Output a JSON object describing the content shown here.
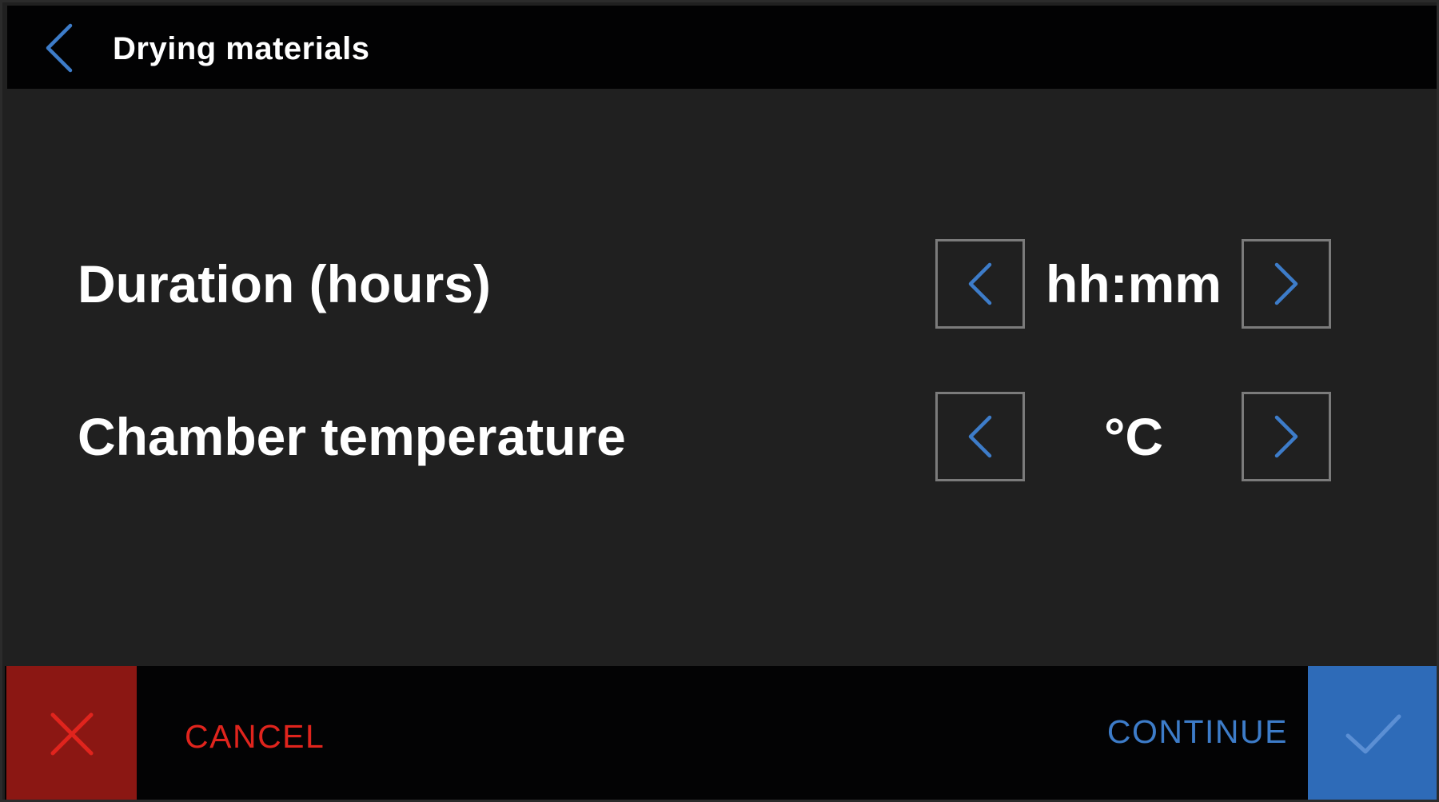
{
  "header": {
    "title": "Drying materials",
    "back_icon": "chevron-left-icon"
  },
  "settings": {
    "duration": {
      "label": "Duration (hours)",
      "value": "hh:mm",
      "decrease_icon": "chevron-left-icon",
      "increase_icon": "chevron-right-icon"
    },
    "temperature": {
      "label": "Chamber temperature",
      "value": "°C",
      "decrease_icon": "chevron-left-icon",
      "increase_icon": "chevron-right-icon"
    }
  },
  "footer": {
    "cancel_label": "CANCEL",
    "cancel_icon": "close-icon",
    "continue_label": "CONTINUE",
    "continue_icon": "checkmark-icon"
  },
  "colors": {
    "accent_blue": "#3d7cc9",
    "cancel_red": "#e0241d",
    "cancel_bg": "#8b1713",
    "continue_bg": "#2e6bb8",
    "background": "#202020",
    "bar_background": "#020203"
  }
}
